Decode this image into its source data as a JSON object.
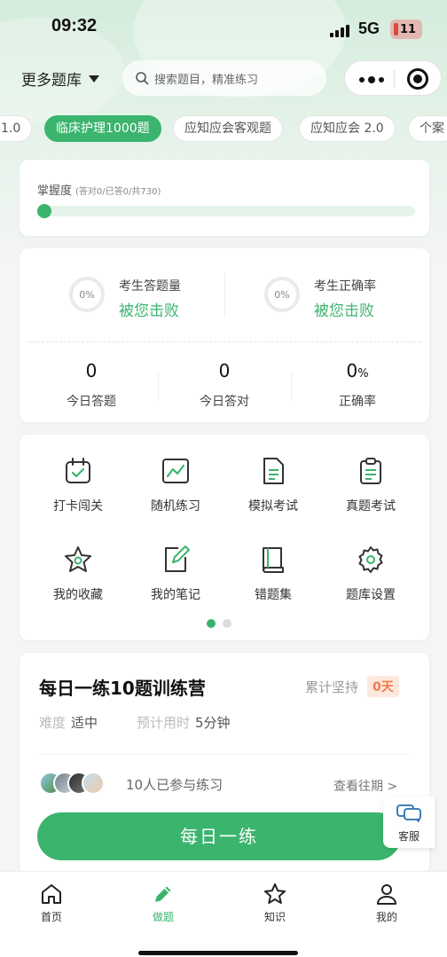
{
  "status_bar": {
    "time": "09:32",
    "network": "5G",
    "battery": "11"
  },
  "header": {
    "more_bank_label": "更多题库",
    "search_placeholder": "搜索题目，精准练习"
  },
  "tabs": [
    "1.0",
    "临床护理1000题",
    "应知应会客观题",
    "应知应会 2.0",
    "个案"
  ],
  "active_tab_index": 1,
  "mastery": {
    "label": "掌握度",
    "detail": "(答对0/已答0/共730)",
    "progress_fraction": 0
  },
  "stats": {
    "left": {
      "ring": "0%",
      "title": "考生答题量",
      "sub": "被您击败"
    },
    "right": {
      "ring": "0%",
      "title": "考生正确率",
      "sub": "被您击败"
    },
    "today_answered": {
      "value": "0",
      "label": "今日答题"
    },
    "today_correct": {
      "value": "0",
      "label": "今日答对"
    },
    "accuracy": {
      "value": "0",
      "unit": "%",
      "label": "正确率"
    }
  },
  "grid": [
    {
      "label": "打卡闯关",
      "icon": "calendar-check-icon"
    },
    {
      "label": "随机练习",
      "icon": "chart-line-icon"
    },
    {
      "label": "模拟考试",
      "icon": "document-icon"
    },
    {
      "label": "真题考试",
      "icon": "clipboard-icon"
    },
    {
      "label": "我的收藏",
      "icon": "star-icon"
    },
    {
      "label": "我的笔记",
      "icon": "note-edit-icon"
    },
    {
      "label": "错题集",
      "icon": "book-icon"
    },
    {
      "label": "题库设置",
      "icon": "gear-icon"
    }
  ],
  "pager": {
    "pages": 2,
    "current": 1
  },
  "daily": {
    "title": "每日一练10题训练营",
    "persist_label": "累计坚持",
    "days": "0天",
    "difficulty_label": "难度",
    "difficulty": "适中",
    "time_label": "预计用时",
    "time": "5分钟",
    "participants": "10人已参与练习",
    "history_link": "查看往期 >",
    "cta": "每日一练"
  },
  "service": {
    "label": "客服"
  },
  "tabbar": [
    {
      "label": "首页",
      "icon": "home-icon"
    },
    {
      "label": "做题",
      "icon": "pencil-icon"
    },
    {
      "label": "知识",
      "icon": "star-outline-icon"
    },
    {
      "label": "我的",
      "icon": "user-icon"
    }
  ],
  "colors": {
    "accent": "#3bb46e",
    "badge_bg": "#fde8df",
    "badge_text": "#f07a4c"
  }
}
